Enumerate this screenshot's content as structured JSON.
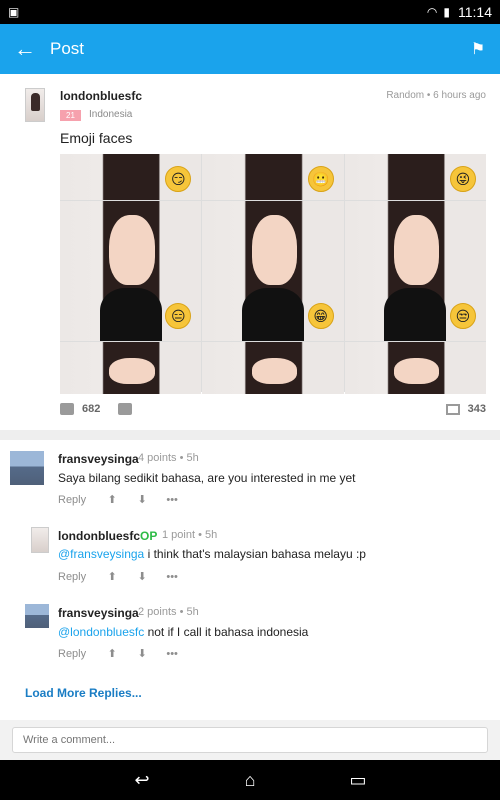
{
  "statusbar": {
    "time": "11:14"
  },
  "appbar": {
    "title": "Post",
    "back_icon": "back-arrow-icon",
    "flag_icon": "flag-icon"
  },
  "post": {
    "username": "londonbluesfc",
    "meta": "Random • 6 hours ago",
    "level": "21",
    "country": "Indonesia",
    "caption": "Emoji faces",
    "likes": "682",
    "comments": "343",
    "emoji_icons": [
      "smirk-emoji-icon",
      "grimace-emoji-icon",
      "tongue-emoji-icon",
      "neutral-emoji-icon",
      "grin-emoji-icon",
      "unamused-emoji-icon"
    ]
  },
  "comments": [
    {
      "user": "fransveysinga",
      "op": "",
      "meta": "4 points • 5h",
      "mention": "",
      "text": "Saya bilang sedikit bahasa, are you interested in me yet",
      "reply": "Reply"
    },
    {
      "user": "londonbluesfc",
      "op": "OP",
      "meta": "1 point • 5h",
      "mention": "@fransveysinga",
      "text": " i think that's malaysian bahasa melayu :p",
      "reply": "Reply"
    },
    {
      "user": "fransveysinga",
      "op": "",
      "meta": "2 points • 5h",
      "mention": "@londonbluesfc",
      "text": " not if I call it bahasa indonesia",
      "reply": "Reply"
    }
  ],
  "load_more": "Load More Replies...",
  "composer": {
    "placeholder": "Write a comment..."
  },
  "colors": {
    "accent": "#1aa3ec",
    "op": "#2dbb46",
    "mention": "#1aa3ec"
  }
}
